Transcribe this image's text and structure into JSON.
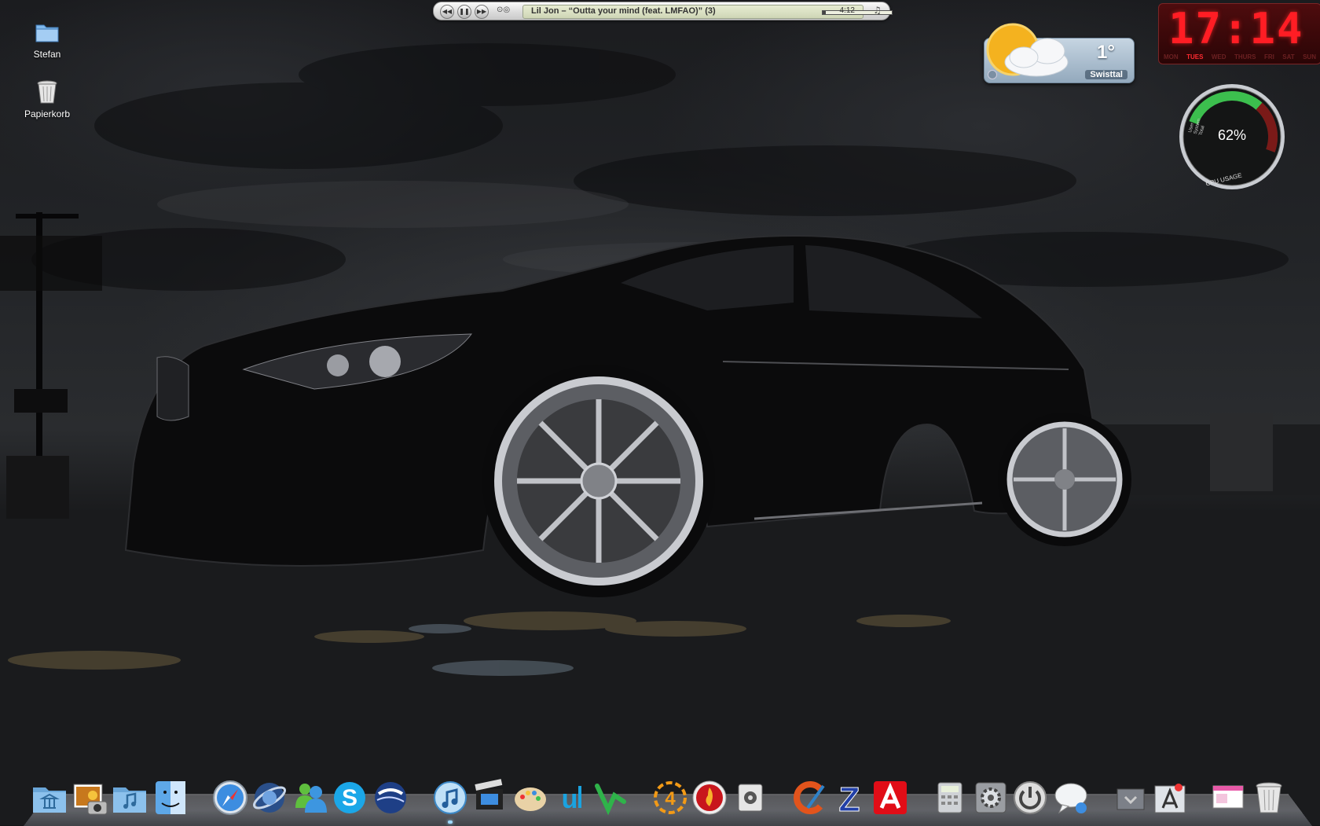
{
  "desktop": {
    "icons": [
      {
        "label": "Stefan",
        "icon": "folder-icon"
      },
      {
        "label": "Papierkorb",
        "icon": "trash-icon"
      }
    ]
  },
  "itunes": {
    "track": "Lil Jon – “Outta your mind (feat. LMFAO)” (3)",
    "time": "4:12",
    "progress": 0.04,
    "controls": [
      "previous-icon",
      "pause-icon",
      "next-icon"
    ]
  },
  "weather": {
    "temperature": "1°",
    "city": "Swisttal",
    "condition_icon": "sun-cloud-icon"
  },
  "clock": {
    "time": "17:14",
    "days": [
      "MON",
      "TUES",
      "WED",
      "THURS",
      "FRI",
      "SAT",
      "SUN"
    ],
    "active_day": "TUES"
  },
  "cpu": {
    "percent_label": "62%",
    "usage": 0.62,
    "title": "CPU USAGE",
    "legend": [
      "User",
      "System",
      "Total"
    ]
  },
  "dock": {
    "items": [
      {
        "icon": "applications-folder-icon"
      },
      {
        "icon": "photos-folder-icon"
      },
      {
        "icon": "music-folder-icon"
      },
      {
        "icon": "finder-icon"
      },
      {
        "icon": "safari-icon"
      },
      {
        "icon": "browser-icon"
      },
      {
        "icon": "messenger-icon"
      },
      {
        "icon": "skype-icon"
      },
      {
        "icon": "google-earth-icon"
      },
      {
        "icon": "itunes-icon"
      },
      {
        "icon": "movie-maker-icon"
      },
      {
        "icon": "paint-icon"
      },
      {
        "icon": "ulead-icon"
      },
      {
        "icon": "vectorworks-icon"
      },
      {
        "icon": "icq-icon"
      },
      {
        "icon": "burner-icon"
      },
      {
        "icon": "system-info-icon"
      },
      {
        "icon": "ccleaner-icon"
      },
      {
        "icon": "z-app-icon"
      },
      {
        "icon": "avira-icon"
      },
      {
        "icon": "calculator-icon"
      },
      {
        "icon": "settings-icon"
      },
      {
        "icon": "power-icon"
      },
      {
        "icon": "chat-icon"
      },
      {
        "icon": "stack-icon"
      },
      {
        "icon": "app-store-icon"
      },
      {
        "icon": "documents-icon"
      },
      {
        "icon": "trash-icon"
      }
    ]
  }
}
